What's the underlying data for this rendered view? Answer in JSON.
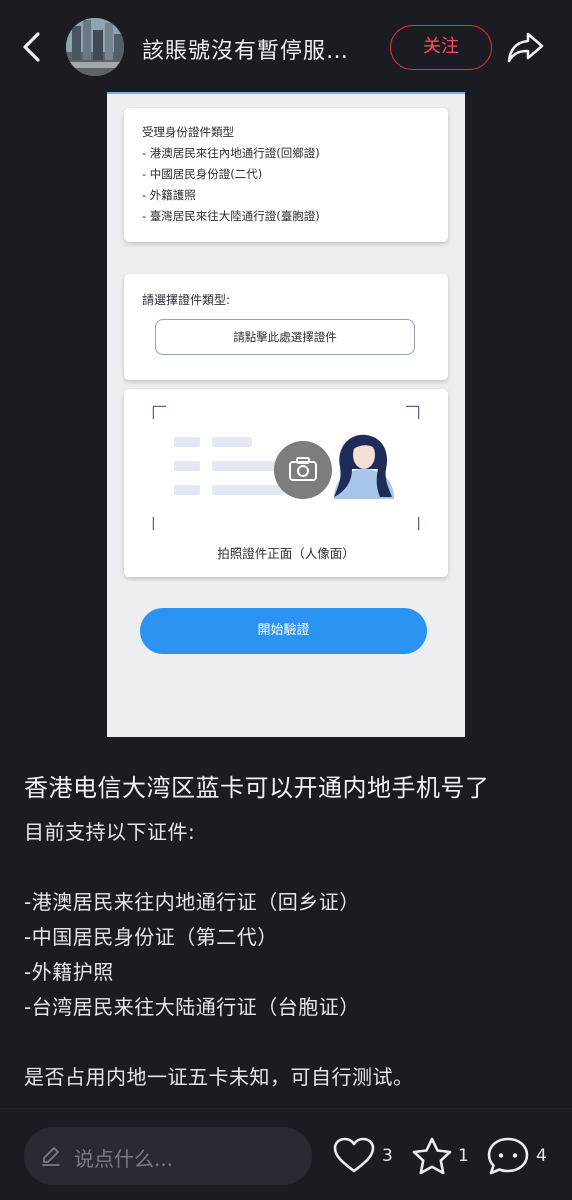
{
  "header": {
    "author_name": "該賬號沒有暫停服…",
    "follow_label": "关注"
  },
  "screenshot": {
    "id_types_card": {
      "title": "受理身份證件類型",
      "items": [
        "- 港澳居民來往內地通行證(回鄉證)",
        "- 中國居民身份證(二代)",
        "- 外籍護照",
        "- 臺灣居民來往大陸通行證(臺胞證)"
      ]
    },
    "select_card": {
      "prompt": "請選擇證件類型:",
      "button_label": "請點擊此處選擇證件"
    },
    "photo_card": {
      "caption": "拍照證件正面（人像面）"
    },
    "start_button_label": "開始驗證"
  },
  "post": {
    "title": "香港电信大湾区蓝卡可以开通内地手机号了",
    "lines": [
      "目前支持以下证件:",
      "",
      "-港澳居民来往内地通行证（回乡证）",
      "-中国居民身份证（第二代）",
      "-外籍护照",
      "-台湾居民来往大陆通行证（台胞证）",
      "",
      "是否占用内地一证五卡未知，可自行测试。"
    ]
  },
  "bottom_bar": {
    "comment_placeholder": "说点什么...",
    "like_count": "3",
    "collect_count": "1",
    "comment_count": "4"
  },
  "colors": {
    "background": "#1b1b22",
    "follow_red": "#e0313d",
    "verify_blue": "#2b93f2"
  },
  "icons": [
    "back-icon",
    "share-icon",
    "camera-icon",
    "pencil-icon",
    "heart-icon",
    "star-icon",
    "comment-icon"
  ]
}
